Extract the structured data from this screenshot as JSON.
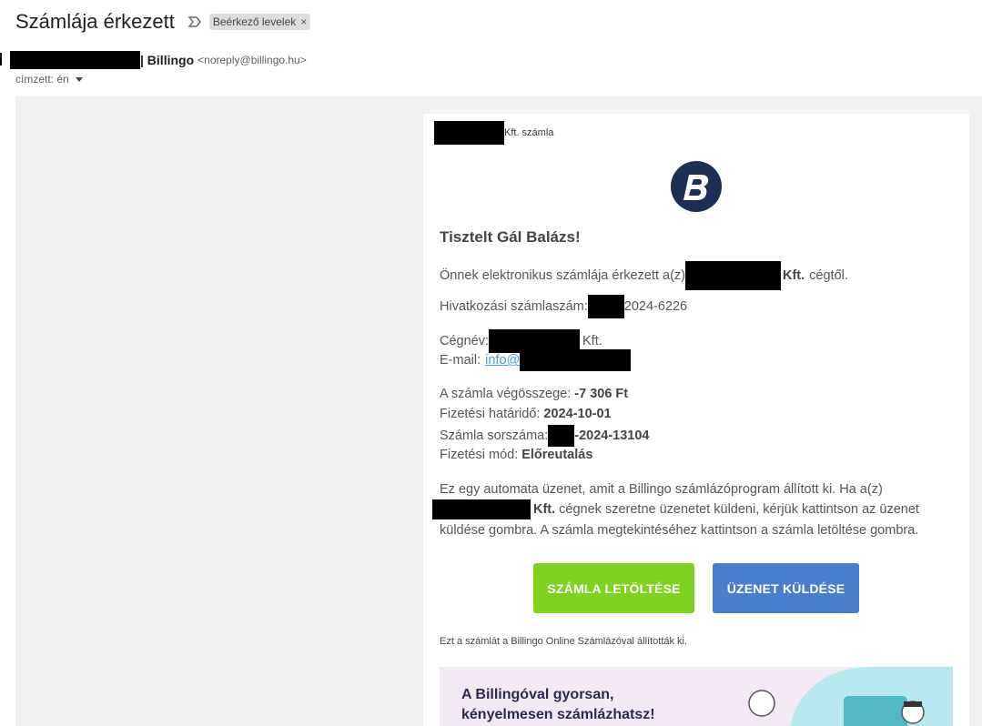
{
  "email": {
    "subject": "Számlája érkezett",
    "label_chip": "Beérkező levelek",
    "label_close": "×",
    "sender_name": "| Billingo",
    "sender_email": "<noreply@billingo.hu>",
    "to_label": "címzett: én"
  },
  "body": {
    "header_suffix": "Kft. számla",
    "greeting": "Tisztelt Gál Balázs!",
    "intro_before": "Önnek elektronikus számlája érkezett a(z)",
    "intro_company_suffix": "Kft.",
    "intro_after": "cégtől.",
    "ref_label": "Hivatkozási számlaszám:",
    "ref_value": "2024-6226",
    "company_label": "Cégnév:",
    "company_suffix": "Kft.",
    "email_label": "E-mail:",
    "email_link": "info@",
    "total_label": "A számla végösszege:",
    "total_value": "-7 306 Ft",
    "due_label": "Fizetési határidő:",
    "due_value": "2024-10-01",
    "serial_label": "Számla sorszáma:",
    "serial_value": "-2024-13104",
    "payment_label": "Fizetési mód:",
    "payment_value": "Előreutalás",
    "auto_line1": "Ez egy automata üzenet, amit a Billingo számlázóprogram állított ki. Ha a(z)",
    "auto_line2_company": "Kft.",
    "auto_line2_rest": "cégnek szeretne üzenetet küldeni, kérjük kattintson az üzenet",
    "auto_line3": "küldése gombra. A számla megtekintéséhez kattintson a számla letöltése gombra.",
    "btn_download": "SZÁMLA LETÖLTÉSE",
    "btn_message": "ÜZENET KÜLDÉSE",
    "footer_note": "Ezt a számlát a Billingo Online Számlázóval állították ki.",
    "promo_line1": "A Billingóval gyorsan,",
    "promo_line2": "kényelmesen számlázhatsz!"
  },
  "colors": {
    "button_green": "#7ed321",
    "button_blue": "#4a7dcc",
    "logo_bg": "#1b2e54",
    "link": "#4a9fd6"
  }
}
